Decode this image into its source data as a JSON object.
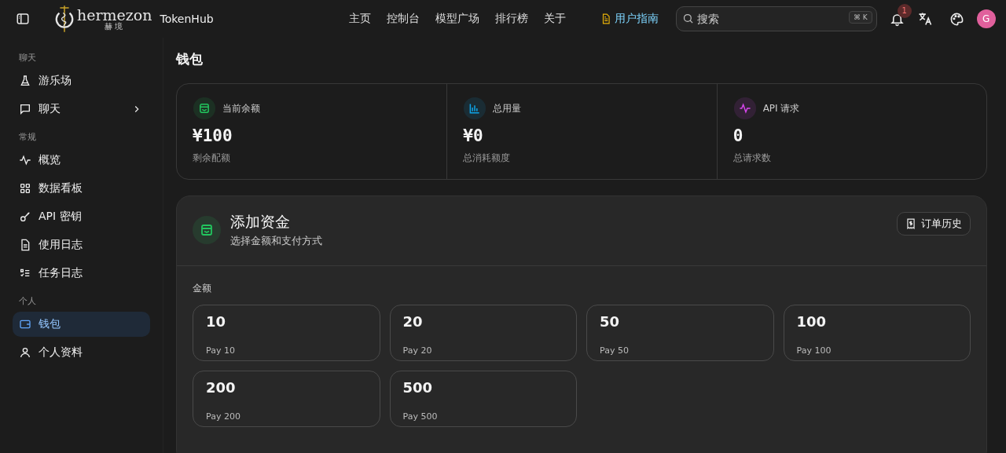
{
  "header": {
    "logo": {
      "wordmark": "hermezon",
      "subtitle": "赫境"
    },
    "app_name": "TokenHub",
    "nav": [
      {
        "label": "主页",
        "selected": false
      },
      {
        "label": "控制台",
        "selected": false
      },
      {
        "label": "模型广场",
        "selected": false
      },
      {
        "label": "排行榜",
        "selected": false
      },
      {
        "label": "关于",
        "selected": false
      }
    ],
    "guide_link": "用户指南",
    "search": {
      "placeholder": "搜索",
      "shortcut": "⌘ K"
    },
    "notifications": "1",
    "avatar": "G"
  },
  "sidebar": {
    "sections": [
      {
        "title": "聊天",
        "items": [
          {
            "label": "游乐场",
            "selected": false
          },
          {
            "label": "聊天",
            "selected": false,
            "expandable": true
          }
        ]
      },
      {
        "title": "常规",
        "items": [
          {
            "label": "概览",
            "selected": false
          },
          {
            "label": "数据看板",
            "selected": false
          },
          {
            "label": "API 密钥",
            "selected": false
          },
          {
            "label": "使用日志",
            "selected": false
          },
          {
            "label": "任务日志",
            "selected": false
          }
        ]
      },
      {
        "title": "个人",
        "items": [
          {
            "label": "钱包",
            "selected": true
          },
          {
            "label": "个人资料",
            "selected": false
          }
        ]
      }
    ]
  },
  "page_title": "钱包",
  "stats": [
    {
      "label": "当前余额",
      "value": "¥100",
      "caption": "剩余配额",
      "color": "#22c55e"
    },
    {
      "label": "总用量",
      "value": "¥0",
      "caption": "总消耗额度",
      "color": "#0ea5e9"
    },
    {
      "label": "API 请求",
      "value": "0",
      "caption": "总请求数",
      "color": "#d946ef"
    }
  ],
  "add_funds": {
    "title": "添加资金",
    "subtitle": "选择金额和支付方式",
    "history_button": "订单历史",
    "amount_label": "金额",
    "amounts": [
      {
        "value": "10",
        "caption": "Pay 10",
        "selected": false
      },
      {
        "value": "20",
        "caption": "Pay 20",
        "selected": false
      },
      {
        "value": "50",
        "caption": "Pay 50",
        "selected": false
      },
      {
        "value": "100",
        "caption": "Pay 100",
        "selected": false
      },
      {
        "value": "200",
        "caption": "Pay 200",
        "selected": false
      },
      {
        "value": "500",
        "caption": "Pay 500",
        "selected": false
      }
    ]
  }
}
